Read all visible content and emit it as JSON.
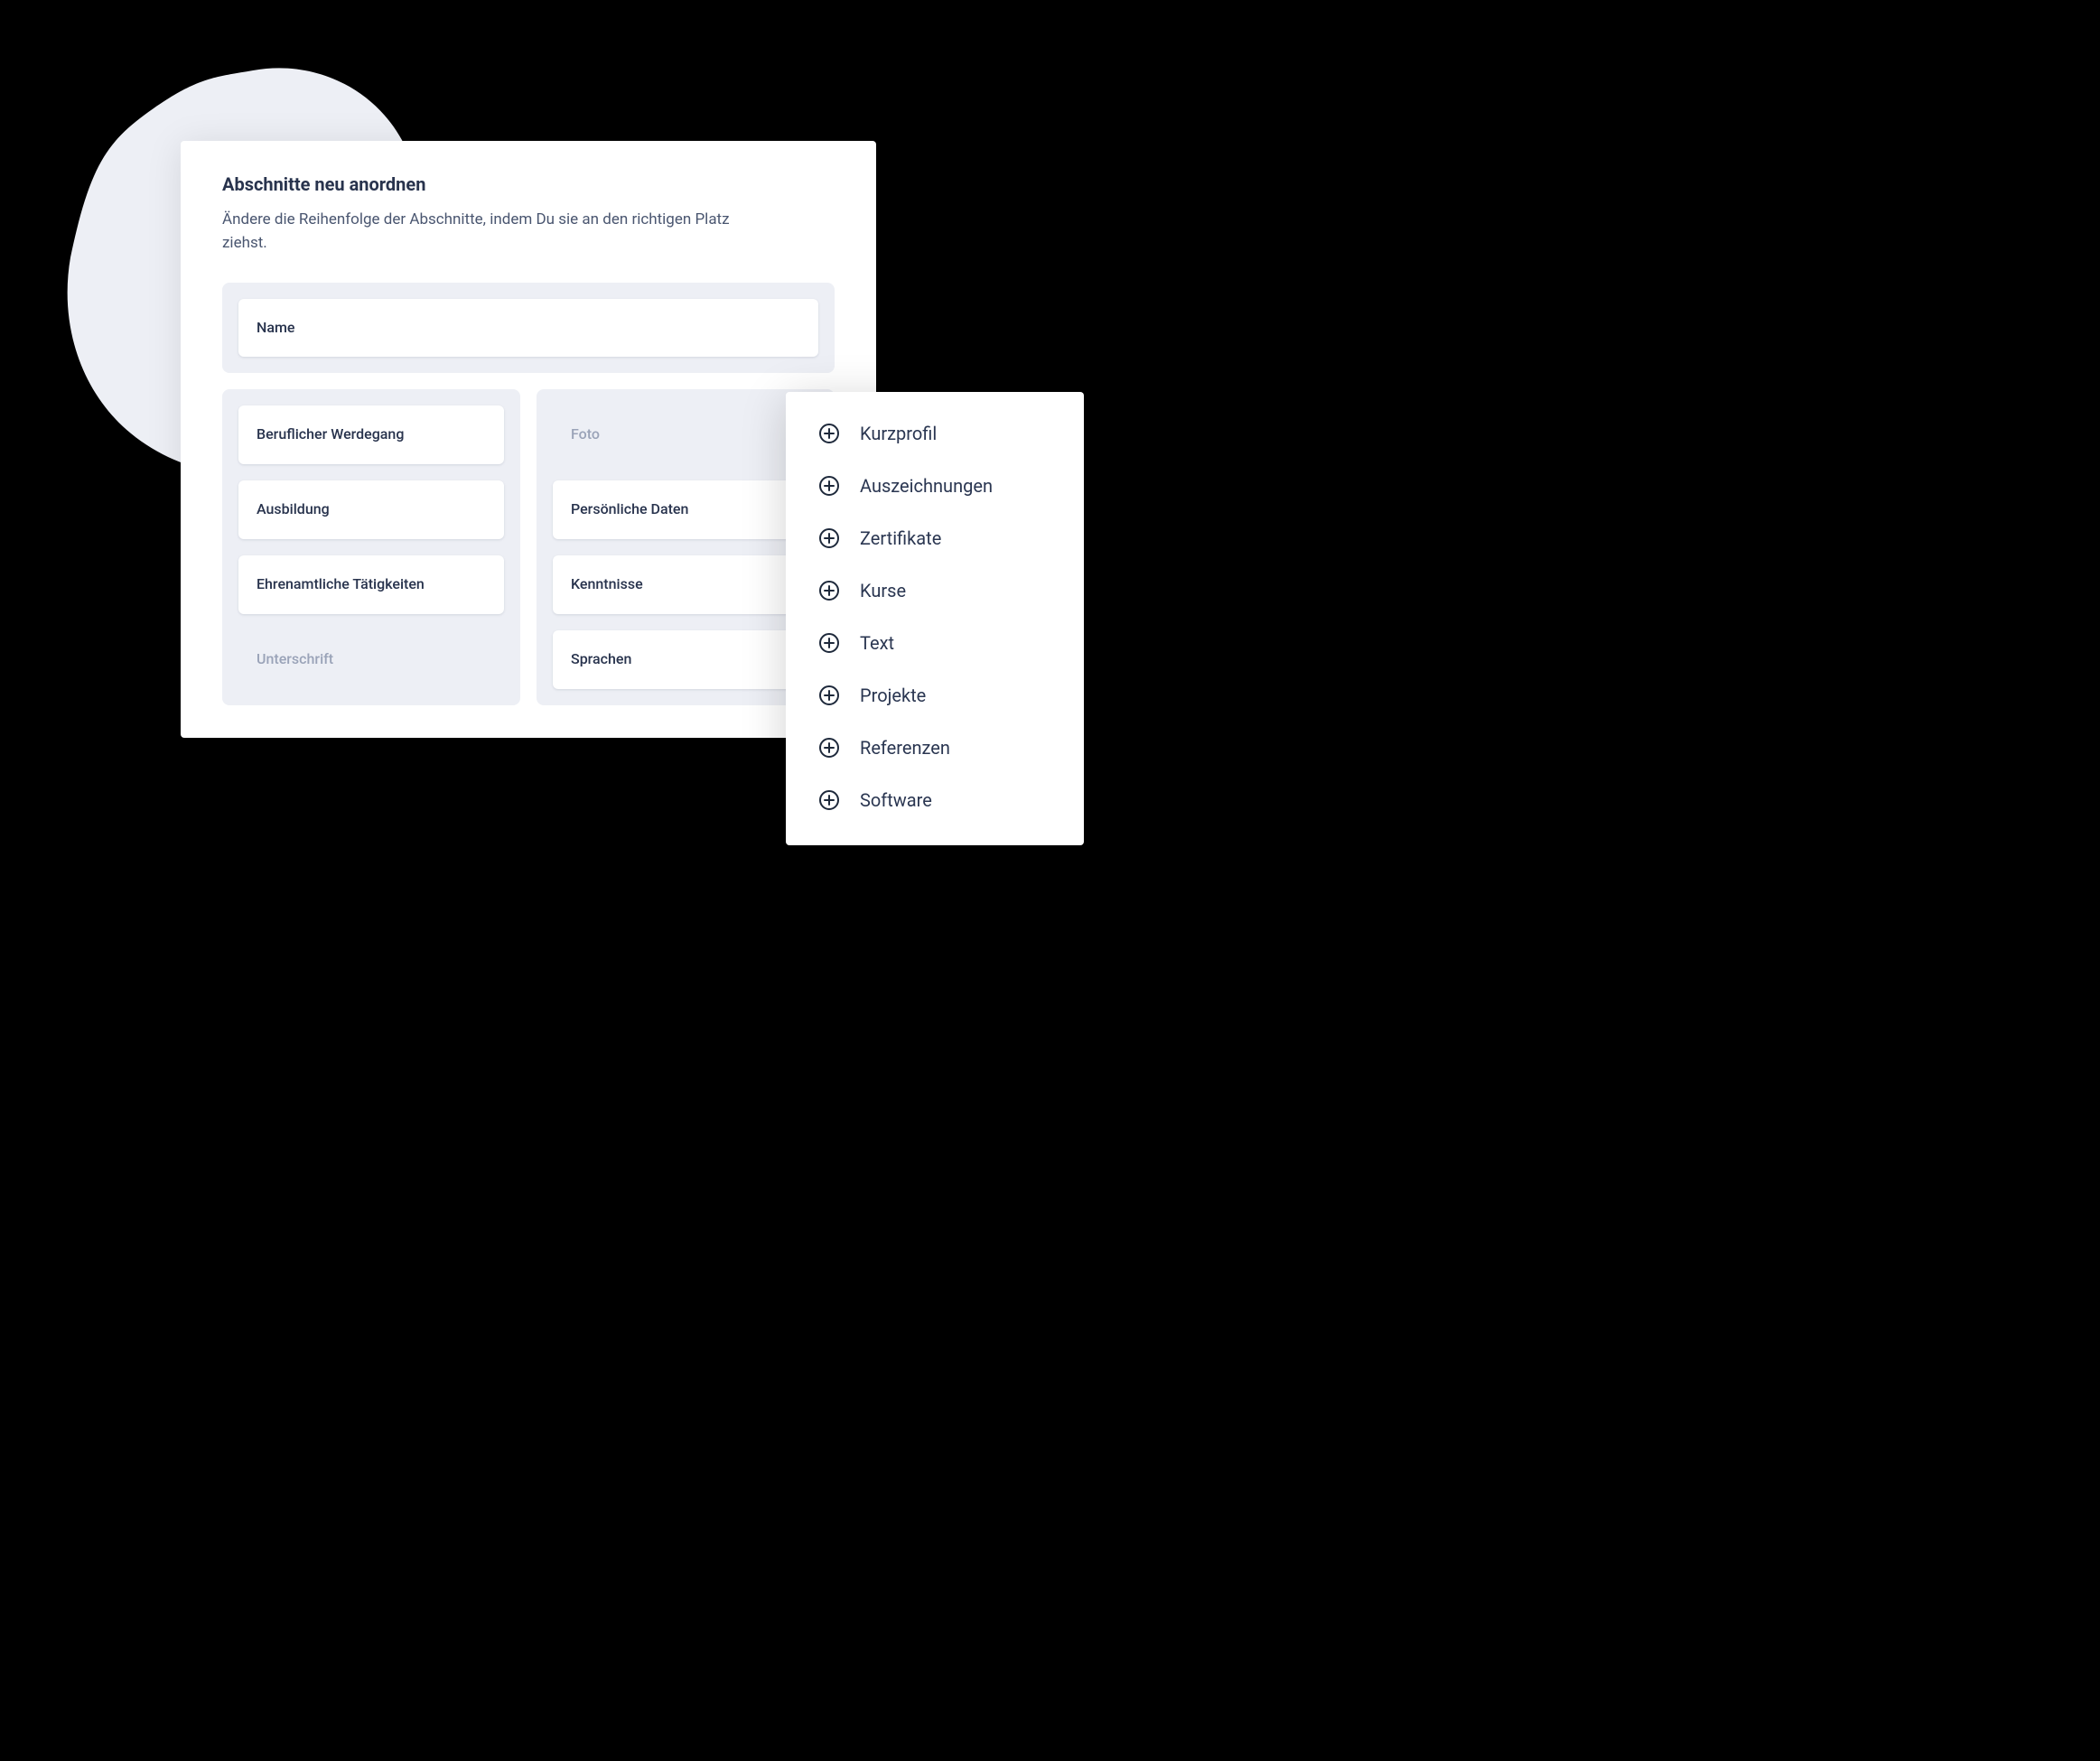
{
  "main": {
    "title": "Abschnitte neu anordnen",
    "subtitle": "Ändere die Reihenfolge der Abschnitte, indem Du sie an den richtigen Platz ziehst.",
    "nameSection": "Name",
    "leftColumn": [
      {
        "label": "Beruflicher Werdegang",
        "disabled": false
      },
      {
        "label": "Ausbildung",
        "disabled": false
      },
      {
        "label": "Ehrenamtliche Tätigkeiten",
        "disabled": false
      },
      {
        "label": "Unterschrift",
        "disabled": true
      }
    ],
    "rightColumn": [
      {
        "label": "Foto",
        "disabled": true
      },
      {
        "label": "Persönliche Daten",
        "disabled": false
      },
      {
        "label": "Kenntnisse",
        "disabled": false
      },
      {
        "label": "Sprachen",
        "disabled": false
      }
    ]
  },
  "addPanel": {
    "items": [
      "Kurzprofil",
      "Auszeichnungen",
      "Zertifikate",
      "Kurse",
      "Text",
      "Projekte",
      "Referenzen",
      "Software"
    ]
  }
}
